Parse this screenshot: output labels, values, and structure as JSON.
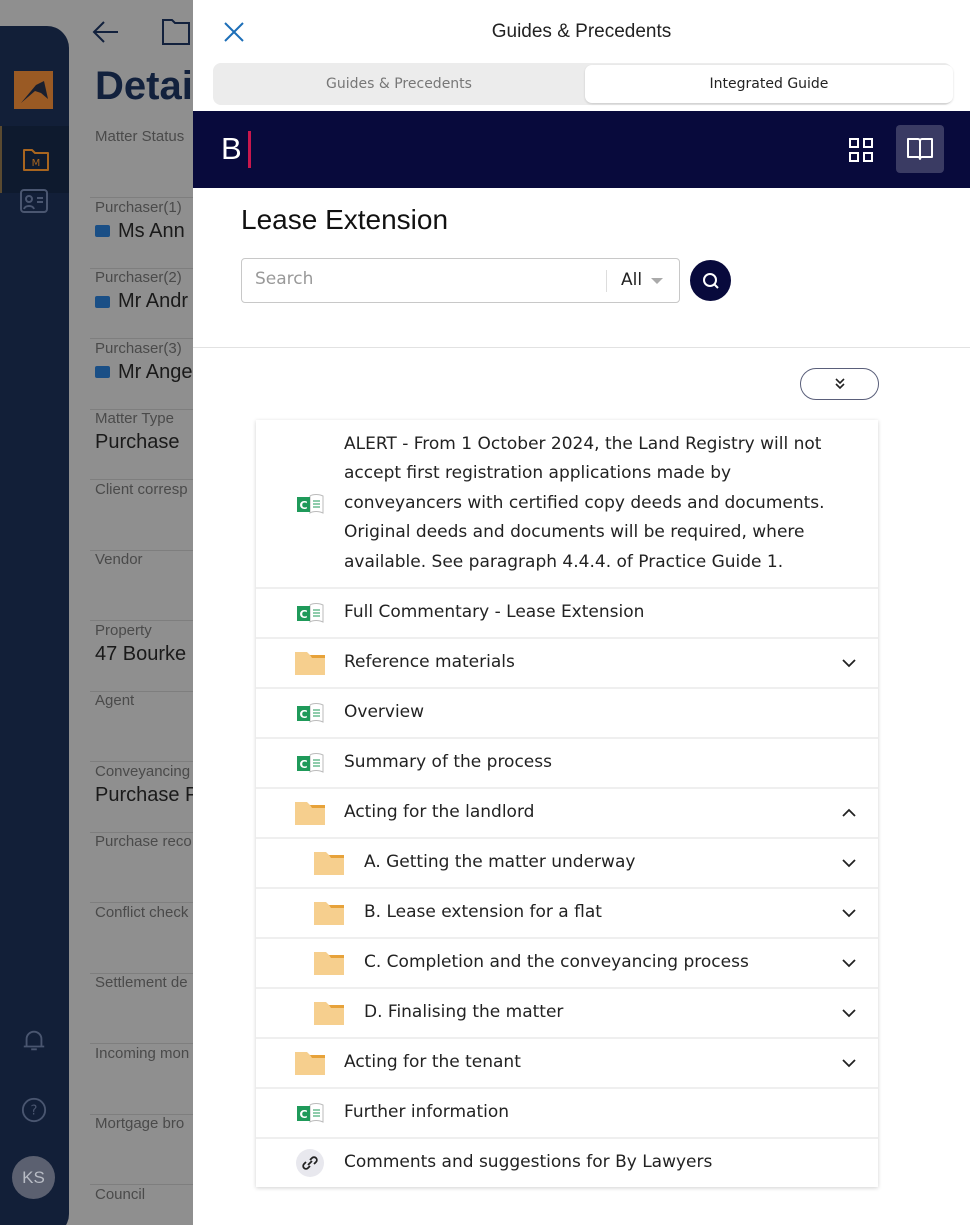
{
  "background": {
    "details_title": "Detai",
    "user_initials": "KS",
    "fields": [
      {
        "label": "Matter Status",
        "value": ""
      },
      {
        "label": "Purchaser(1)",
        "value": "Ms Ann",
        "contact": true
      },
      {
        "label": "Purchaser(2)",
        "value": "Mr Andr",
        "contact": true
      },
      {
        "label": "Purchaser(3)",
        "value": "Mr Ange",
        "contact": true
      },
      {
        "label": "Matter Type",
        "value": "Purchase"
      },
      {
        "label": "Client corresp",
        "value": ""
      },
      {
        "label": "Vendor",
        "value": ""
      },
      {
        "label": "Property",
        "value": "47 Bourke"
      },
      {
        "label": "Agent",
        "value": ""
      },
      {
        "label": "Conveyancing",
        "value": "Purchase P"
      },
      {
        "label": "Purchase reco",
        "value": ""
      },
      {
        "label": "Conflict check",
        "value": ""
      },
      {
        "label": "Settlement de",
        "value": ""
      },
      {
        "label": "Incoming mon",
        "value": ""
      },
      {
        "label": "Mortgage bro",
        "value": ""
      },
      {
        "label": "Council",
        "value": ""
      }
    ]
  },
  "panel": {
    "title": "Guides & Precedents",
    "tabs": [
      {
        "label": "Guides & Precedents",
        "active": false
      },
      {
        "label": "Integrated Guide",
        "active": true
      }
    ],
    "brand_logo": "B",
    "brand_color": "#080a3c",
    "accent_color": "#c8174d",
    "heading": "Lease Extension",
    "search": {
      "placeholder": "Search",
      "value": "",
      "filter": "All"
    },
    "items": [
      {
        "icon": "commentary",
        "text": "ALERT - From 1 October 2024, the Land Registry will not accept first registration applications made by conveyancers with certified copy deeds and documents. Original deeds and documents will be required, where available. See paragraph 4.4.4. of Practice Guide 1.",
        "alert": true
      },
      {
        "icon": "commentary",
        "text": "Full Commentary - Lease Extension"
      },
      {
        "icon": "folder",
        "text": "Reference materials",
        "chevron": "down"
      },
      {
        "icon": "commentary",
        "text": "Overview"
      },
      {
        "icon": "commentary",
        "text": "Summary of the process"
      },
      {
        "icon": "folder",
        "text": "Acting for the landlord",
        "chevron": "up"
      },
      {
        "icon": "folder",
        "text": "A. Getting the matter underway",
        "chevron": "down",
        "sub": true
      },
      {
        "icon": "folder",
        "text": "B. Lease extension for a flat",
        "chevron": "down",
        "sub": true
      },
      {
        "icon": "folder",
        "text": "C. Completion and the conveyancing process",
        "chevron": "down",
        "sub": true
      },
      {
        "icon": "folder",
        "text": "D. Finalising the matter",
        "chevron": "down",
        "sub": true
      },
      {
        "icon": "folder",
        "text": "Acting for the tenant",
        "chevron": "down"
      },
      {
        "icon": "commentary",
        "text": "Further information"
      },
      {
        "icon": "link",
        "text": "Comments and suggestions for By Lawyers"
      }
    ]
  }
}
